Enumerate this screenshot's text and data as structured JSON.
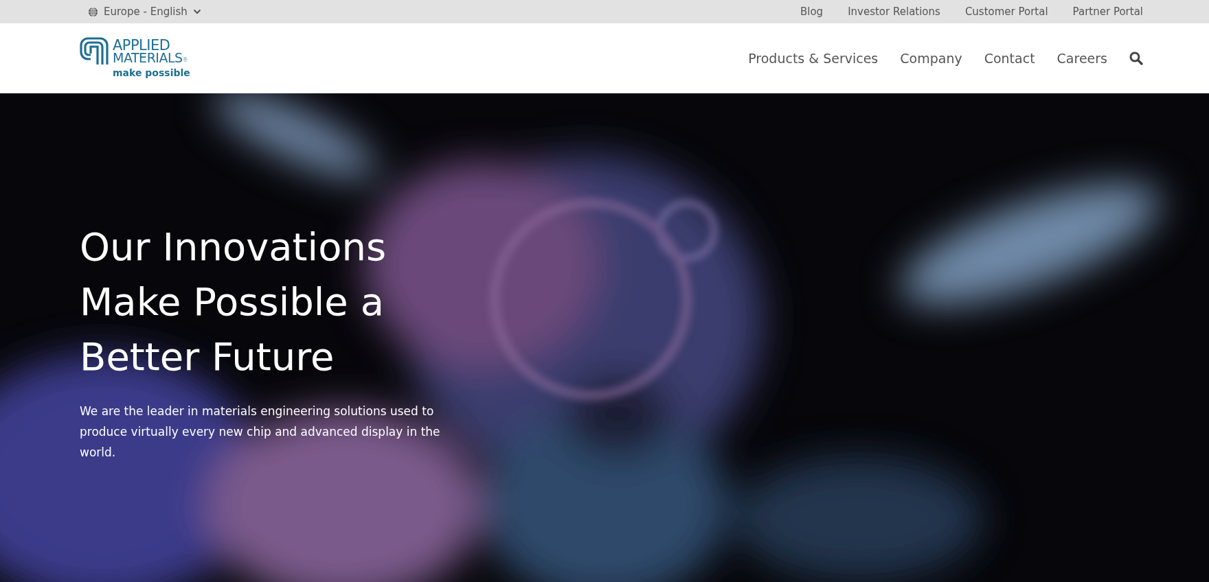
{
  "utility_bar": {
    "region": {
      "label": "Europe - English"
    },
    "links": [
      "Blog",
      "Investor Relations",
      "Customer Portal",
      "Partner Portal"
    ]
  },
  "header": {
    "logo": {
      "line_1": "APPLIED",
      "line_2": "MATERIALS",
      "mark": "®",
      "tagline": "make possible"
    },
    "nav": [
      "Products & Services",
      "Company",
      "Contact",
      "Careers"
    ]
  },
  "hero": {
    "title": "Our Innovations Make Possible a Better Future",
    "text": "We are the leader in materials engineering solutions used to produce virtually every new chip and advanced display in the world."
  }
}
